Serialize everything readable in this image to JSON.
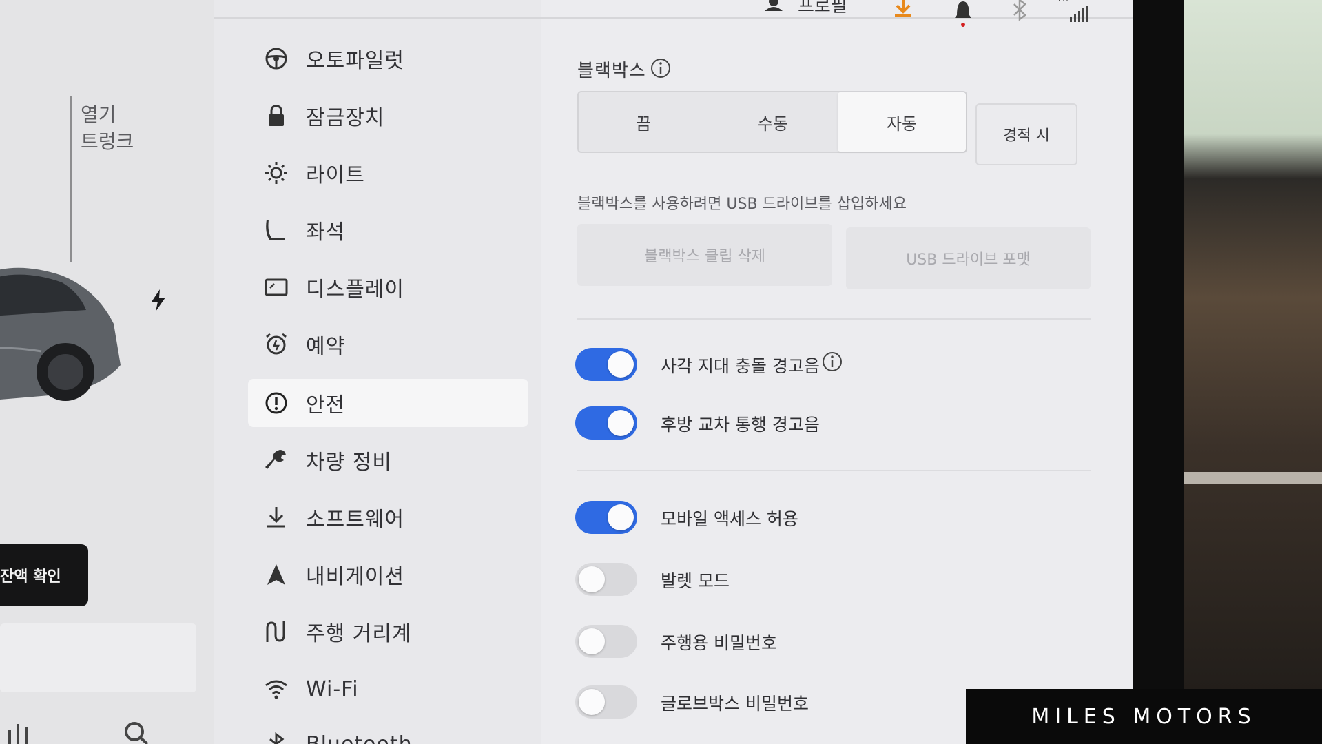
{
  "status_bar": {
    "profile_label": "프로필",
    "network_label": "LTE",
    "colors": {
      "download": "#e8891c",
      "bell_dot": "#d32020"
    }
  },
  "left_panel": {
    "open_label": "열기",
    "trunk_label": "트렁크",
    "fluid_button_label": "잔액 확인"
  },
  "menu": {
    "items": [
      {
        "label": "오토파일럿",
        "icon": "steering-wheel-icon"
      },
      {
        "label": "잠금장치",
        "icon": "lock-icon"
      },
      {
        "label": "라이트",
        "icon": "light-icon"
      },
      {
        "label": "좌석",
        "icon": "seat-icon"
      },
      {
        "label": "디스플레이",
        "icon": "display-icon"
      },
      {
        "label": "예약",
        "icon": "alarm-clock-icon"
      },
      {
        "label": "안전",
        "icon": "safety-alert-icon",
        "active": true
      },
      {
        "label": "차량 정비",
        "icon": "wrench-icon"
      },
      {
        "label": "소프트웨어",
        "icon": "download-icon"
      },
      {
        "label": "내비게이션",
        "icon": "navigation-icon"
      },
      {
        "label": "주행 거리계",
        "icon": "trip-icon"
      },
      {
        "label": "Wi-Fi",
        "icon": "wifi-icon"
      },
      {
        "label": "Bluetooth",
        "icon": "bluetooth-icon"
      }
    ]
  },
  "dashcam": {
    "title": "블랙박스",
    "options": [
      "끔",
      "수동",
      "자동"
    ],
    "selected": "자동",
    "extra_option": "경적 시",
    "usb_note": "블랙박스를 사용하려면 USB 드라이브를 삽입하세요",
    "delete_clips_label": "블랙박스 클립 삭제",
    "format_usb_label": "USB 드라이브 포맷"
  },
  "toggles": [
    {
      "label": "사각 지대 충돌 경고음",
      "on": true,
      "info": true
    },
    {
      "label": "후방 교차 통행 경고음",
      "on": true,
      "info": false
    },
    {
      "label": "모바일 액세스 허용",
      "on": true,
      "info": false
    },
    {
      "label": "발렛 모드",
      "on": false,
      "info": false
    },
    {
      "label": "주행용 비밀번호",
      "on": false,
      "info": false
    },
    {
      "label": "글로브박스 비밀번호",
      "on": false,
      "info": false
    }
  ],
  "watermark": "MILES MOTORS",
  "colors": {
    "toggle_on": "#2f6ae3",
    "toggle_off": "#d9d9dc"
  }
}
